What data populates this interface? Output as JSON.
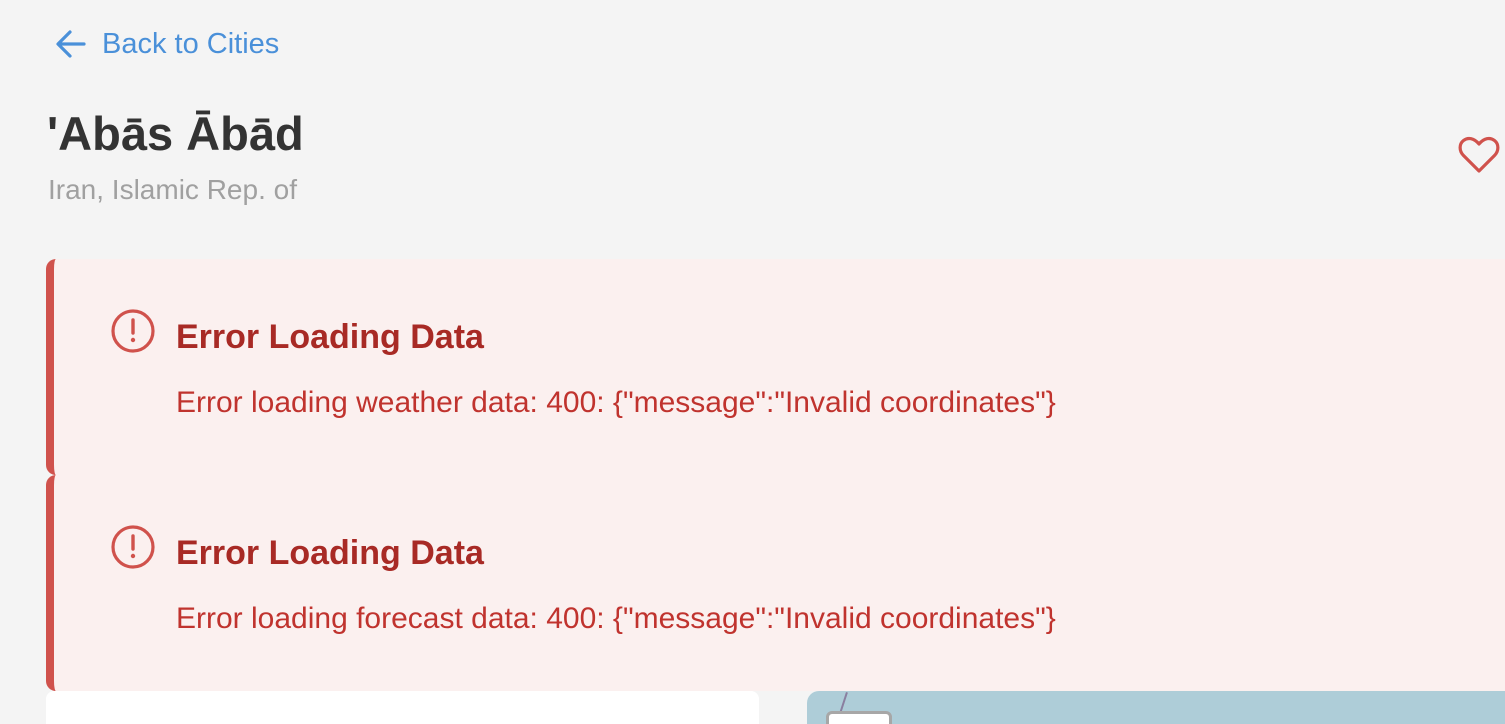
{
  "nav": {
    "back_label": "Back to Cities",
    "back_icon": "arrow-left-icon"
  },
  "city": {
    "name": "'Abās Ābād",
    "country": "Iran, Islamic Rep. of",
    "favorite_icon": "heart-outline-icon"
  },
  "errors": [
    {
      "title": "Error Loading Data",
      "message": "Error loading weather data: 400: {\"message\":\"Invalid coordinates\"}",
      "icon": "alert-circle-icon"
    },
    {
      "title": "Error Loading Data",
      "message": "Error loading forecast data: 400: {\"message\":\"Invalid coordinates\"}",
      "icon": "alert-circle-icon"
    }
  ],
  "colors": {
    "link": "#4a90d9",
    "error_accent": "#d0524c",
    "error_background": "#fbf0ef",
    "favorite": "#d0524c",
    "map_water": "#aecdd8"
  }
}
